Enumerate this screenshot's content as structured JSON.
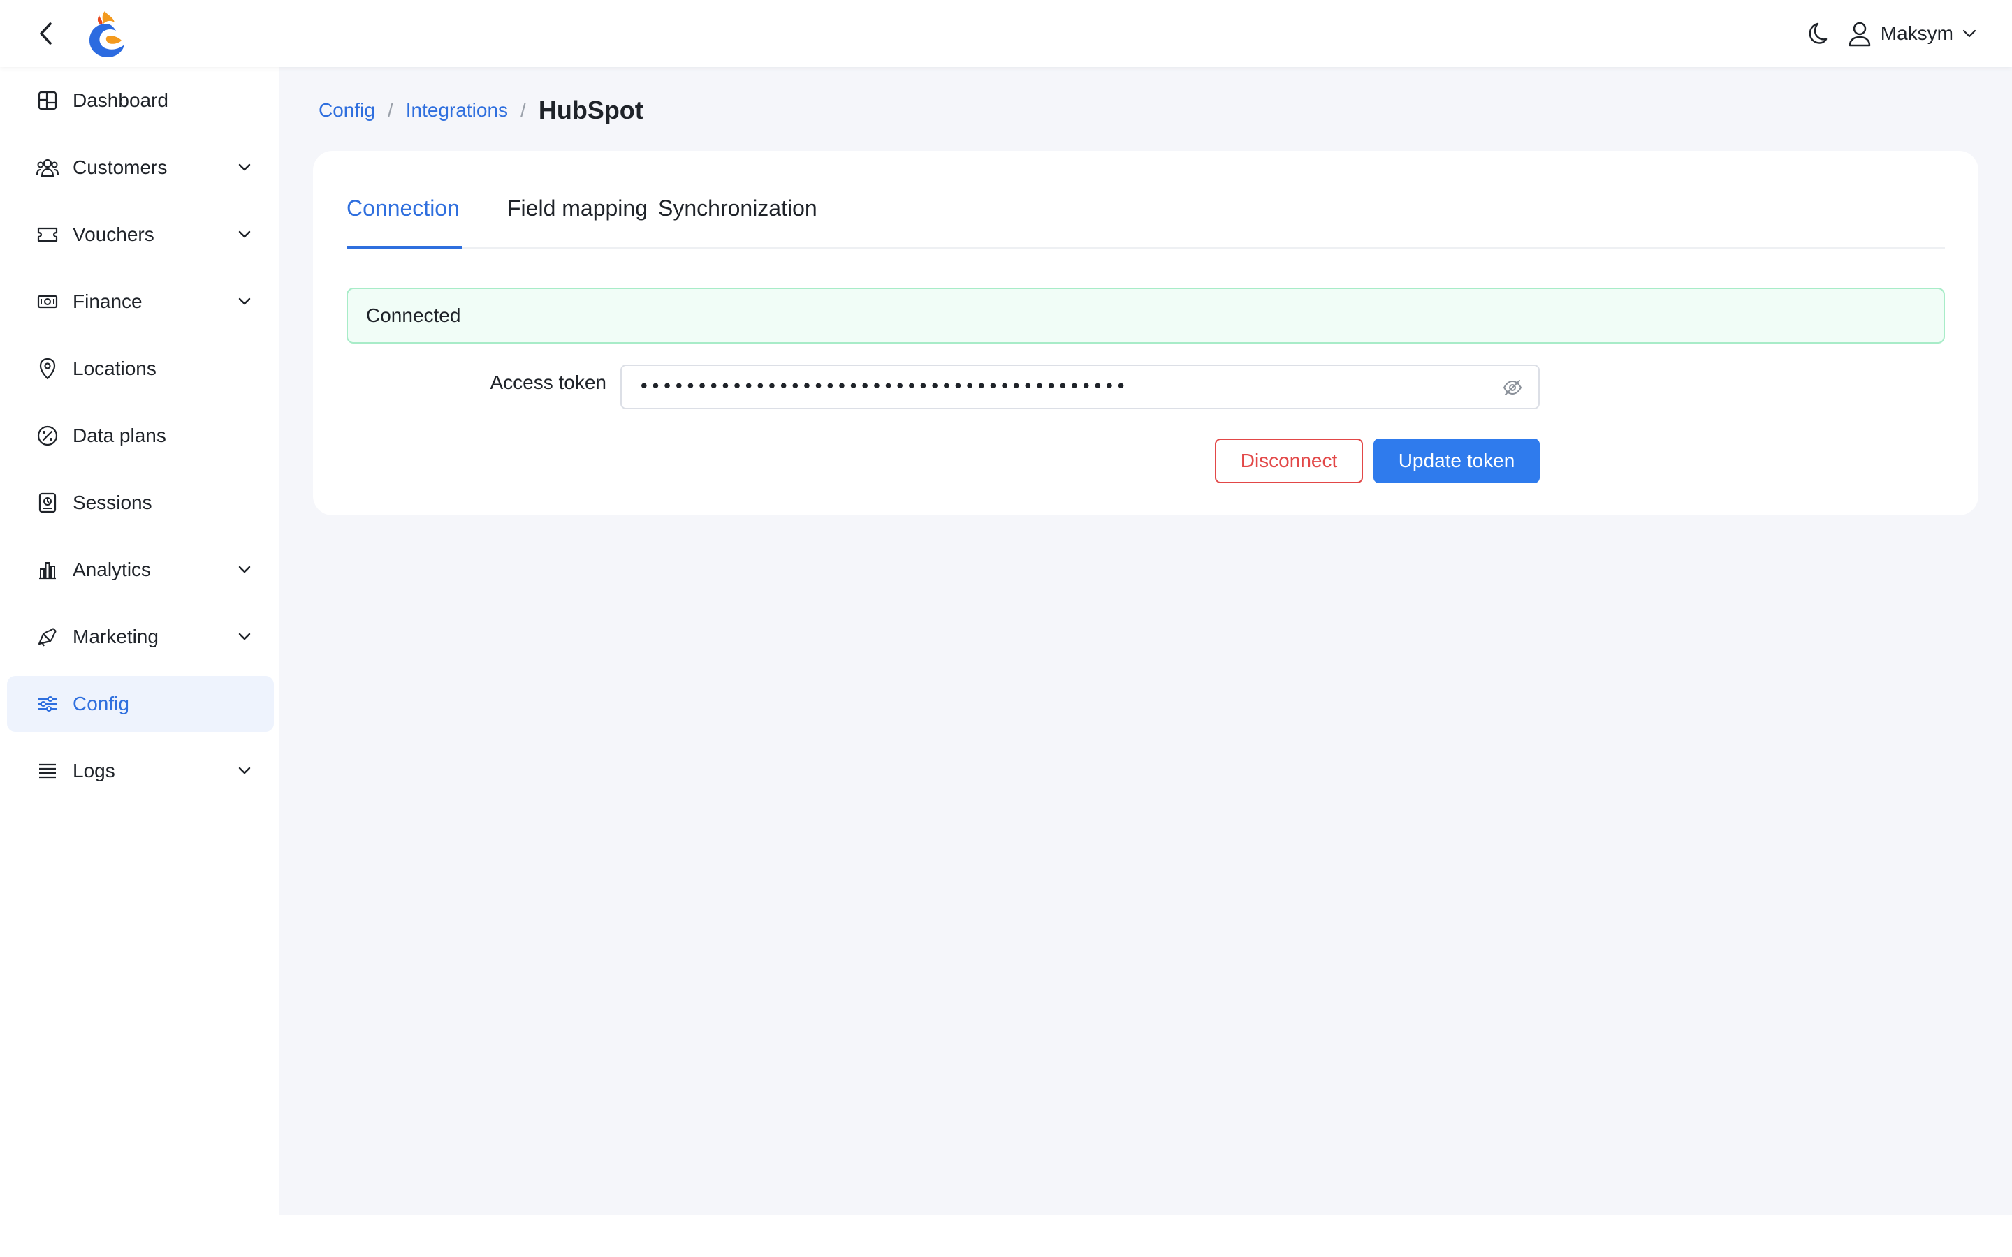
{
  "header": {
    "back_icon": "chevron-left-icon",
    "logo": "app-logo",
    "theme_icon": "moon-icon",
    "user_icon": "user-icon",
    "user_name": "Maksym"
  },
  "sidebar": {
    "items": [
      {
        "label": "Dashboard",
        "icon": "dashboard-icon",
        "expandable": false,
        "active": false
      },
      {
        "label": "Customers",
        "icon": "customers-icon",
        "expandable": true,
        "active": false
      },
      {
        "label": "Vouchers",
        "icon": "voucher-icon",
        "expandable": true,
        "active": false
      },
      {
        "label": "Finance",
        "icon": "finance-icon",
        "expandable": true,
        "active": false
      },
      {
        "label": "Locations",
        "icon": "location-pin-icon",
        "expandable": false,
        "active": false
      },
      {
        "label": "Data plans",
        "icon": "percent-badge-icon",
        "expandable": false,
        "active": false
      },
      {
        "label": "Sessions",
        "icon": "sessions-icon",
        "expandable": false,
        "active": false
      },
      {
        "label": "Analytics",
        "icon": "bar-chart-icon",
        "expandable": true,
        "active": false
      },
      {
        "label": "Marketing",
        "icon": "megaphone-icon",
        "expandable": true,
        "active": false
      },
      {
        "label": "Config",
        "icon": "sliders-icon",
        "expandable": false,
        "active": true
      },
      {
        "label": "Logs",
        "icon": "list-icon",
        "expandable": true,
        "active": false
      }
    ]
  },
  "breadcrumb": {
    "items": [
      "Config",
      "Integrations"
    ],
    "separator": "/",
    "current": "HubSpot"
  },
  "tabs": [
    {
      "label": "Connection",
      "active": true
    },
    {
      "label": "Field mapping",
      "active": false
    },
    {
      "label": "Synchronization",
      "active": false
    }
  ],
  "status": {
    "text": "Connected",
    "color": "#a8ecc8"
  },
  "form": {
    "access_token_label": "Access token",
    "access_token_value": "••••••••••••••••••••••••••••••••••••••••••",
    "visibility_icon": "eye-off-icon"
  },
  "actions": {
    "disconnect_label": "Disconnect",
    "update_label": "Update token"
  },
  "colors": {
    "accent": "#2f6fde",
    "primary_button": "#2f7bed",
    "danger": "#e24848",
    "success_bg": "#f1fdf7"
  }
}
